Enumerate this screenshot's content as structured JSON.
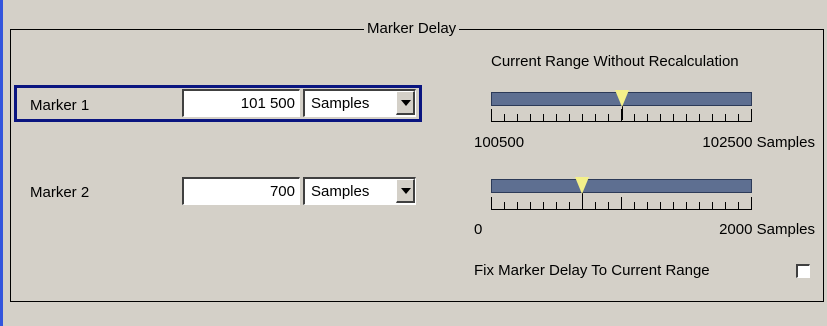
{
  "group": {
    "title": "Marker Delay"
  },
  "range": {
    "heading": "Current Range Without Recalculation"
  },
  "markers": [
    {
      "label": "Marker 1",
      "value": "101 500",
      "unit": "Samples",
      "range_min_label": "100500",
      "range_max_label": "102500 Samples",
      "range_min": 100500,
      "range_max": 102500,
      "current": 101500,
      "focused": true
    },
    {
      "label": "Marker 2",
      "value": "700",
      "unit": "Samples",
      "range_min_label": "0",
      "range_max_label": "2000 Samples",
      "range_min": 0,
      "range_max": 2000,
      "current": 700,
      "focused": false
    }
  ],
  "fix_delay": {
    "label": "Fix Marker Delay To Current Range",
    "checked": false
  },
  "colors": {
    "accent_bar": "#3355dd",
    "focus_border": "#0a1580",
    "range_bar": "#5e6f91",
    "pointer": "#f4f08a"
  },
  "icons": {
    "dropdown": "chevron-down-icon",
    "pointer": "marker-pointer-icon"
  }
}
